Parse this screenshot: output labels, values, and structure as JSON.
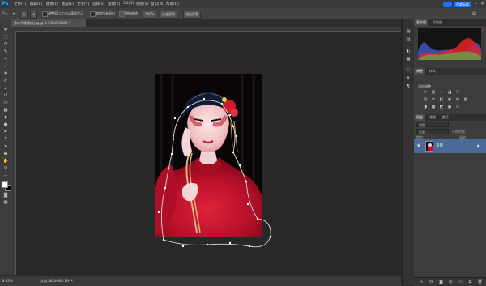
{
  "app": {
    "logo": "Ps"
  },
  "menu": [
    "文件(F)",
    "编辑(E)",
    "图像(I)",
    "图层(L)",
    "文字(Y)",
    "选择(S)",
    "滤镜(T)",
    "3D(D)",
    "视图(V)",
    "窗口(W)",
    "帮助(H)"
  ],
  "cloud_button": "百度云盘",
  "options": {
    "tool_icon": "zoom-in-icon",
    "resize_windows_label": "调整窗口大小以满屏显示",
    "zoom_all_label": "缩放所有窗口",
    "scrubby_zoom_label": "细微缩放",
    "btn_100": "100%",
    "btn_fit": "适合屏幕",
    "btn_fill": "填充屏幕"
  },
  "document": {
    "tab_title": "第二节课素材.jpg @ 8.33%(RGB/8) *"
  },
  "status": {
    "zoom": "8.33%",
    "doc_info": "文档:88.1M/88.1M"
  },
  "panels": {
    "histogram_tabs": [
      "直方图",
      "导航器"
    ],
    "adjust_tabs": [
      "调整",
      "样式"
    ],
    "adjust_title": "添加调整",
    "layers_tabs": [
      "图层",
      "通道",
      "路径"
    ],
    "layer_filter": "类型",
    "blend_mode": "正常",
    "opacity_label": "不透明度:",
    "lock_label": "锁定:",
    "fill_label": "填充:",
    "layer_name": "背景"
  },
  "colors": {
    "accent": "#1877f2",
    "layer_selected": "#4b6a98",
    "photo_red": "#c8102e"
  }
}
